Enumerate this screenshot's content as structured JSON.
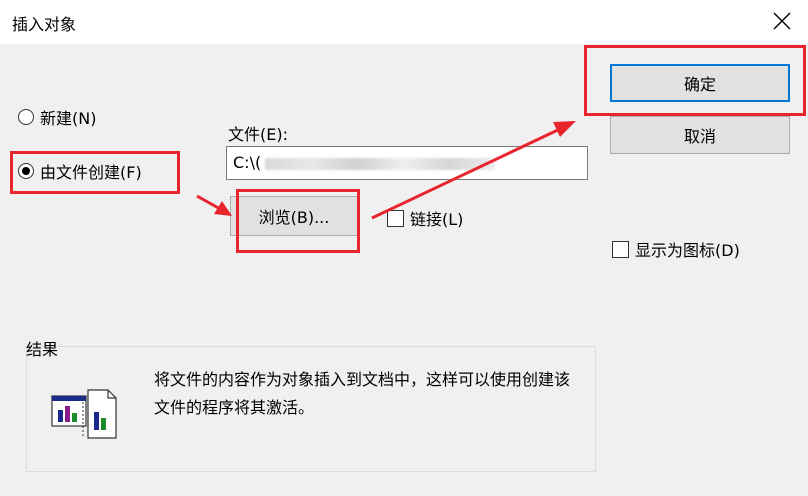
{
  "window": {
    "title": "插入对象"
  },
  "options": {
    "create_new": "新建(N)",
    "create_from_file": "由文件创建(F)"
  },
  "file": {
    "label": "文件(E):",
    "value_prefix": "C:\\("
  },
  "buttons": {
    "ok": "确定",
    "cancel": "取消",
    "browse": "浏览(B)..."
  },
  "checks": {
    "link": "链接(L)",
    "display_as_icon": "显示为图标(D)"
  },
  "result": {
    "label": "结果",
    "text": "将文件的内容作为对象插入到文档中，这样可以使用创建该文件的程序将其激活。"
  },
  "annotation_color": "#e8242c"
}
